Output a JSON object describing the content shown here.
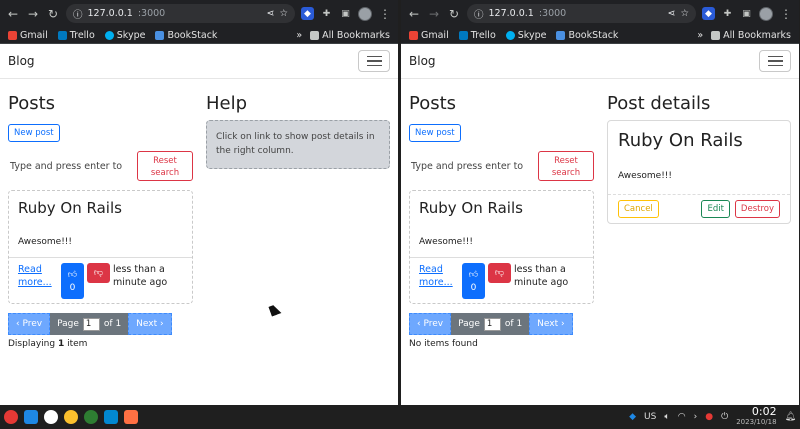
{
  "browser": {
    "url_host": "127.0.0.1",
    "url_port": ":3000",
    "bookmarks": [
      "Gmail",
      "Trello",
      "Skype",
      "BookStack"
    ],
    "all_bookmarks": "All Bookmarks",
    "overflow": "»"
  },
  "app": {
    "brand": "Blog"
  },
  "left": {
    "posts_heading": "Posts",
    "new_post": "New post",
    "search_placeholder": "Type and press enter to",
    "reset_search": "Reset search",
    "post": {
      "title": "Ruby On Rails",
      "body": "Awesome!!!",
      "read_more": "Read more...",
      "likes": "0",
      "time": "less than a minute ago"
    },
    "pager": {
      "prev": "‹ Prev",
      "page_label": "Page",
      "page_value": "1",
      "of_label": "of 1",
      "next": "Next ›",
      "status_prefix": "Displaying",
      "status_count": "1",
      "status_suffix": "item"
    },
    "help_heading": "Help",
    "help_text": "Click on link to show post details in the right column."
  },
  "right": {
    "posts_heading": "Posts",
    "new_post": "New post",
    "search_placeholder": "Type and press enter to",
    "reset_search": "Reset search",
    "post": {
      "title": "Ruby On Rails",
      "body": "Awesome!!!",
      "read_more": "Read more...",
      "likes": "0",
      "time": "less than a minute ago"
    },
    "pager": {
      "prev": "‹ Prev",
      "page_label": "Page",
      "page_value": "1",
      "of_label": "of 1",
      "next": "Next ›",
      "status": "No items found"
    },
    "details_heading": "Post details",
    "details": {
      "title": "Ruby On Rails",
      "body": "Awesome!!!",
      "cancel": "Cancel",
      "edit": "Edit",
      "destroy": "Destroy"
    }
  },
  "taskbar": {
    "lang": "US",
    "time": "0:02",
    "date": "2023/10/18"
  },
  "colors": {
    "primary": "#0d6efd",
    "danger": "#dc3545",
    "warning": "#ffc107",
    "success": "#198754",
    "help_bg": "#d3d6db",
    "pager_bg": "#6ea8fe"
  }
}
